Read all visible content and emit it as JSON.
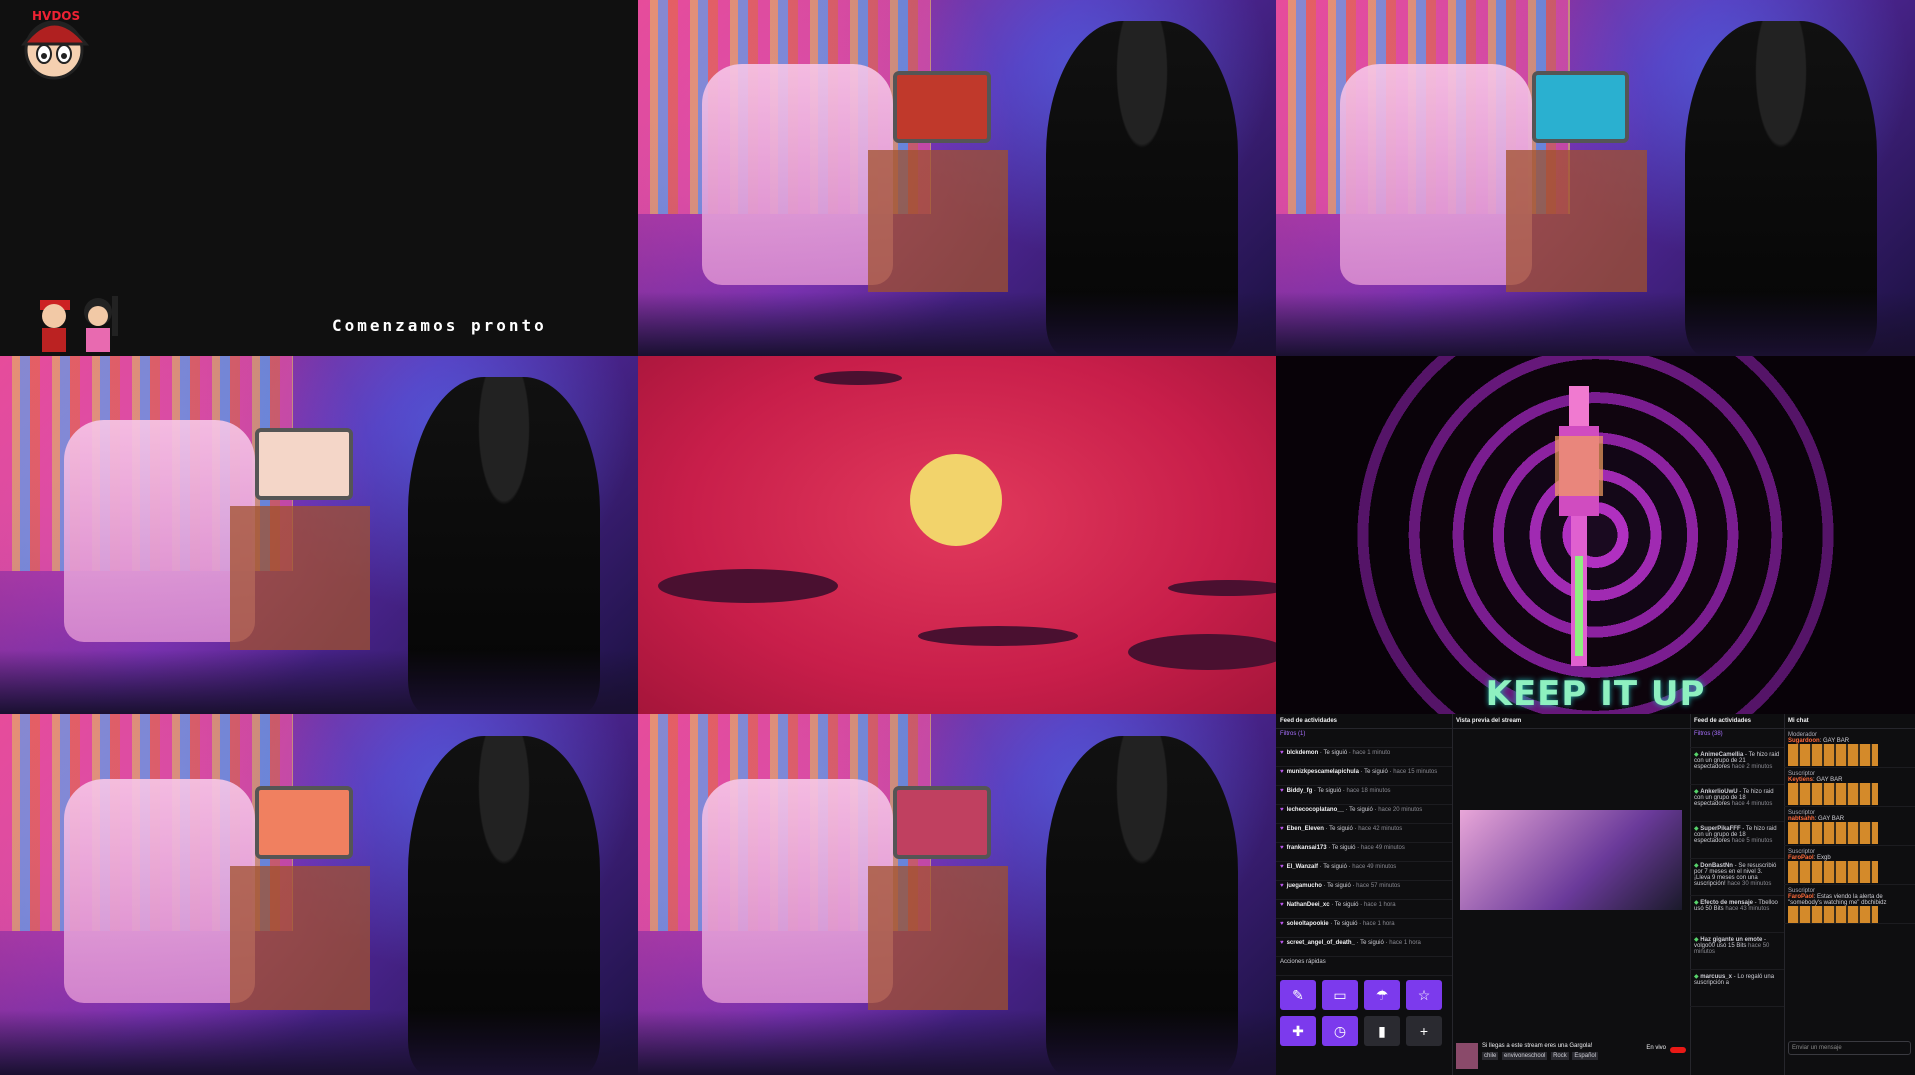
{
  "cells": {
    "starting": {
      "logo_text": "HVDOS",
      "message": "Comenzamos pronto"
    },
    "tunnel": {
      "caption": "KEEP IT UP"
    }
  },
  "dashboard": {
    "feed": {
      "title": "Feed de actividades",
      "filters": "Filtros (1)",
      "items": [
        {
          "user": "blckdemon",
          "text": "Te siguió",
          "time": "hace 1 minuto"
        },
        {
          "user": "munizkpescamelapichula",
          "text": "Te siguió",
          "time": "hace 15 minutos"
        },
        {
          "user": "Biddy_fg",
          "text": "Te siguió",
          "time": "hace 18 minutos"
        },
        {
          "user": "lechecocoplatano__",
          "text": "Te siguió",
          "time": "hace 20 minutos"
        },
        {
          "user": "Eben_Eleven",
          "text": "Te siguió",
          "time": "hace 42 minutos"
        },
        {
          "user": "frankansai173",
          "text": "Te siguió",
          "time": "hace 49 minutos"
        },
        {
          "user": "El_Wanzalf",
          "text": "Te siguió",
          "time": "hace 49 minutos"
        },
        {
          "user": "juegamucho",
          "text": "Te siguió",
          "time": "hace 57 minutos"
        },
        {
          "user": "NathanDeei_xc",
          "text": "Te siguió",
          "time": "hace 1 hora"
        },
        {
          "user": "soleoltapookie",
          "text": "Te siguió",
          "time": "hace 1 hora"
        },
        {
          "user": "screet_angel_of_death_",
          "text": "Te siguió",
          "time": "hace 1 hora"
        }
      ],
      "quick_actions_title": "Acciones rápidas"
    },
    "preview": {
      "title": "Vista previa del stream",
      "stream_title": "Si llegas a este stream eres una Gargola!",
      "tags": [
        "chile",
        "envivoneschool",
        "Rock",
        "Español"
      ],
      "status": "En vivo"
    },
    "activity": {
      "title": "Feed de actividades",
      "filters": "Filtros (38)",
      "items": [
        {
          "user": "AnimeCamellia",
          "text": "Te hizo raid con un grupo de 21 espectadores",
          "time": "hace 2 minutos"
        },
        {
          "user": "AnkerlioUwU",
          "text": "Te hizo raid con un grupo de 18 espectadores",
          "time": "hace 4 minutos"
        },
        {
          "user": "SuperPikaFFF",
          "text": "Te hizo raid con un grupo de 18 espectadores",
          "time": "hace 5 minutos"
        },
        {
          "user": "DonBastNn",
          "text": "Se resuscribió por 7 meses en el nivel 3. ¡Lleva 9 meses con una suscripción!",
          "time": "hace 30 minutos"
        },
        {
          "user": "Efecto de mensaje",
          "text": "Tbelloo usó 50 Bits",
          "time": "hace 43 minutos"
        },
        {
          "user": "Haz gigante un emote",
          "text": "volgo00 usó 15 Bits",
          "time": "hace 50 minutos"
        },
        {
          "user": "marcuus_x",
          "text": "Lo regaló una suscripción a",
          "time": ""
        }
      ]
    },
    "chat": {
      "title": "Mi chat",
      "messages": [
        {
          "role": "Moderador",
          "user": "Sugardoon",
          "text": "GAY BAR"
        },
        {
          "role": "Suscriptor",
          "user": "Keytiens",
          "text": "GAY BAR"
        },
        {
          "role": "Suscriptor",
          "user": "nabtsahh",
          "text": "GAY BAR"
        },
        {
          "role": "Suscriptor",
          "user": "FaroPaol",
          "text": "Exgb"
        },
        {
          "role": "Suscriptor",
          "user": "FaroPaol",
          "text": "Estas viendo la alerta de \"somebody's watching me\" dbchibidz"
        }
      ],
      "input_placeholder": "Enviar un mensaje"
    }
  }
}
